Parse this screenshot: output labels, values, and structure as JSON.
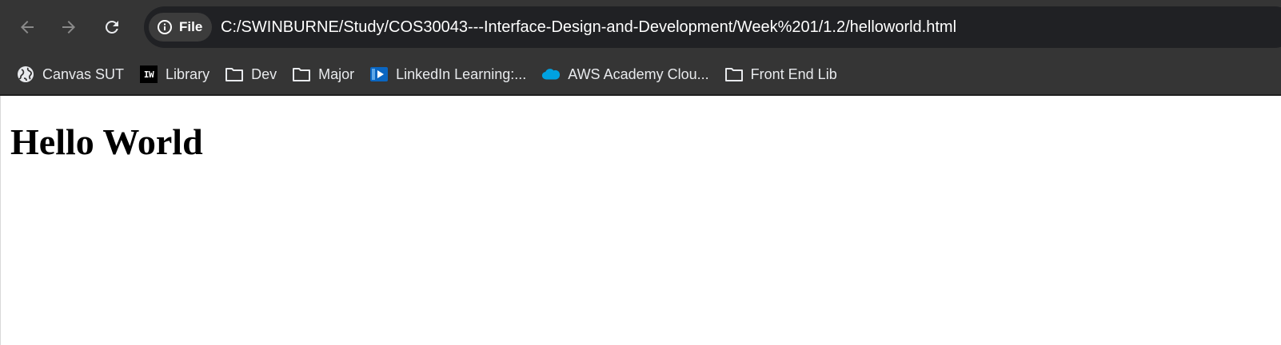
{
  "toolbar": {
    "back_icon": "arrow-left-icon",
    "forward_icon": "arrow-right-icon",
    "reload_icon": "reload-icon",
    "site_info_icon": "info-icon",
    "site_chip_label": "File",
    "url": "C:/SWINBURNE/Study/COS30043---Interface-Design-and-Development/Week%201/1.2/helloworld.html"
  },
  "bookmarks": [
    {
      "label": "Canvas SUT",
      "icon": "globe-icon"
    },
    {
      "label": "Library",
      "icon": "iw-logo-icon"
    },
    {
      "label": "Dev",
      "icon": "folder-icon"
    },
    {
      "label": "Major",
      "icon": "folder-icon"
    },
    {
      "label": "LinkedIn Learning:...",
      "icon": "linkedin-learning-icon"
    },
    {
      "label": "AWS Academy Clou...",
      "icon": "salesforce-cloud-icon"
    },
    {
      "label": "Front End Lib",
      "icon": "folder-icon"
    }
  ],
  "bookmark_iw_text": "IW",
  "page": {
    "heading": "Hello World"
  },
  "colors": {
    "chrome_bg": "#353535",
    "omnibox_bg": "#202124",
    "chip_bg": "#3c3c3c",
    "text_light": "#e8eaed",
    "icon_disabled": "#8a8a8a",
    "linkedin_blue": "#0a66c2",
    "salesforce_blue": "#00a1e0"
  }
}
